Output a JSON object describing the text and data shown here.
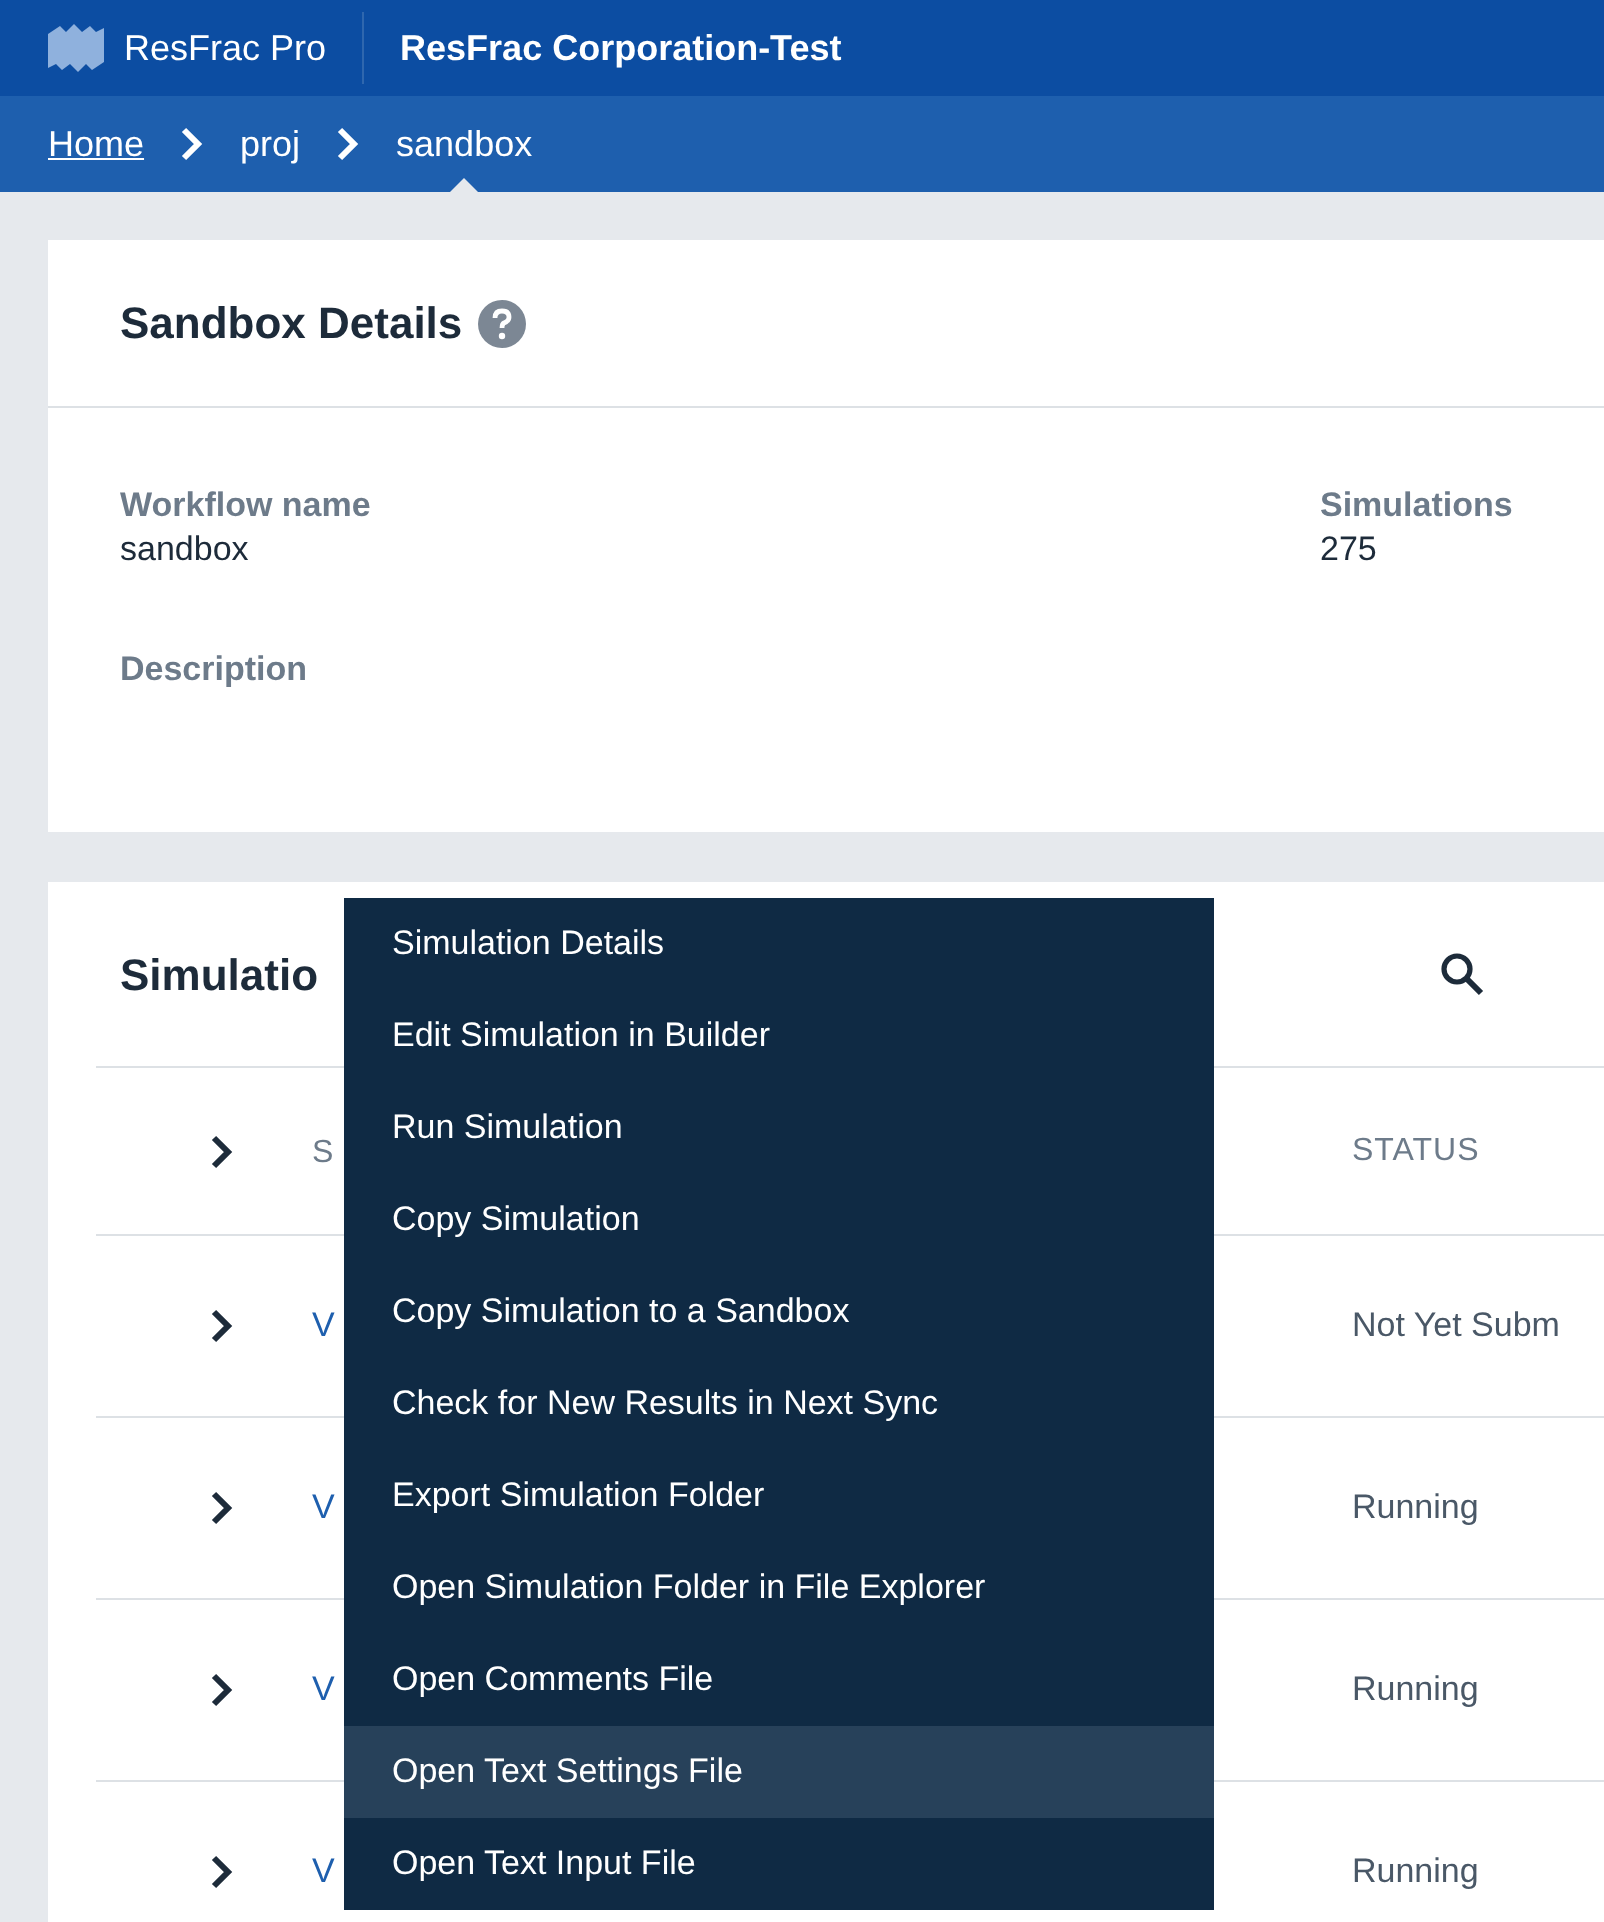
{
  "header": {
    "app_name": "ResFrac Pro",
    "org_name": "ResFrac Corporation-Test"
  },
  "breadcrumbs": [
    {
      "label": "Home",
      "current": false
    },
    {
      "label": "proj",
      "current": false
    },
    {
      "label": "sandbox",
      "current": true
    }
  ],
  "details": {
    "title": "Sandbox Details",
    "fields": [
      {
        "label": "Workflow name",
        "value": "sandbox"
      },
      {
        "label": "Simulations",
        "value": "275"
      }
    ],
    "description_label": "Description"
  },
  "simulations": {
    "title": "Simulatio",
    "columns": [
      "S",
      "STATUS"
    ],
    "rows": [
      {
        "name": "V",
        "status": "Not Yet Subm",
        "expanded": false
      },
      {
        "name": "V",
        "status": "Running",
        "expanded": false
      },
      {
        "name": "V",
        "status": "Running",
        "expanded": false
      },
      {
        "name": "V",
        "status": "Running",
        "expanded": false
      }
    ]
  },
  "context_menu": {
    "items": [
      {
        "label": "Simulation Details",
        "selected": false
      },
      {
        "label": "Edit Simulation in Builder",
        "selected": false
      },
      {
        "label": "Run Simulation",
        "selected": false
      },
      {
        "label": "Copy Simulation",
        "selected": false
      },
      {
        "label": "Copy Simulation to a Sandbox",
        "selected": false
      },
      {
        "label": "Check for New Results in Next Sync",
        "selected": false
      },
      {
        "label": "Export Simulation Folder",
        "selected": false
      },
      {
        "label": "Open Simulation Folder in File Explorer",
        "selected": false
      },
      {
        "label": "Open Comments File",
        "selected": false
      },
      {
        "label": "Open Text Settings File",
        "selected": true
      },
      {
        "label": "Open Text Input File",
        "selected": false
      }
    ]
  }
}
